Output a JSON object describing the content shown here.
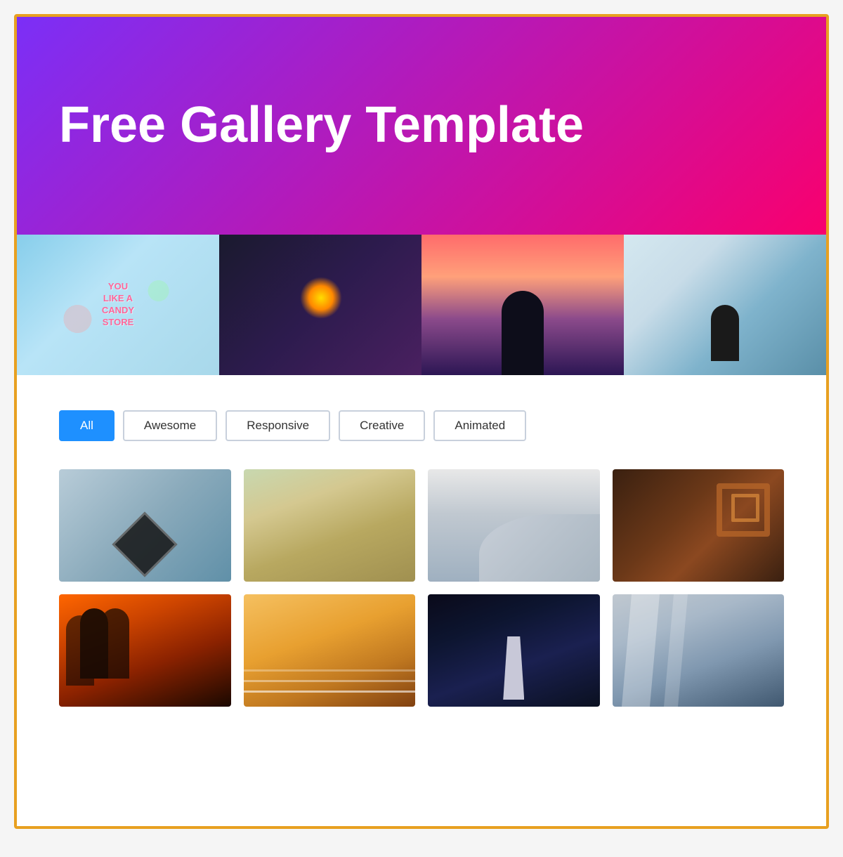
{
  "header": {
    "title": "Free Gallery Template",
    "gradient_start": "#7b2ff7",
    "gradient_end": "#f9006e"
  },
  "filters": {
    "buttons": [
      {
        "label": "All",
        "active": true
      },
      {
        "label": "Awesome",
        "active": false
      },
      {
        "label": "Responsive",
        "active": false
      },
      {
        "label": "Creative",
        "active": false
      },
      {
        "label": "Animated",
        "active": false
      }
    ]
  },
  "banner": {
    "images": [
      {
        "alt": "Candy store text",
        "type": "candy"
      },
      {
        "alt": "Sparkler",
        "type": "sparkler"
      },
      {
        "alt": "Silhouette sunset",
        "type": "silhouette"
      },
      {
        "alt": "Person by water",
        "type": "person"
      }
    ]
  },
  "gallery": {
    "rows": [
      [
        {
          "alt": "Diamond roof architecture",
          "type": "g1"
        },
        {
          "alt": "Rural landscape",
          "type": "g2"
        },
        {
          "alt": "Curved building",
          "type": "g3"
        },
        {
          "alt": "Spiral staircase",
          "type": "g4"
        }
      ],
      [
        {
          "alt": "Sunset church silhouette",
          "type": "g5"
        },
        {
          "alt": "Light trails",
          "type": "g6"
        },
        {
          "alt": "Night city tower",
          "type": "g7"
        },
        {
          "alt": "Glass building",
          "type": "g8"
        }
      ]
    ]
  },
  "candy_text": "YOU\nLIKE A\nCANDY\nSTORE"
}
